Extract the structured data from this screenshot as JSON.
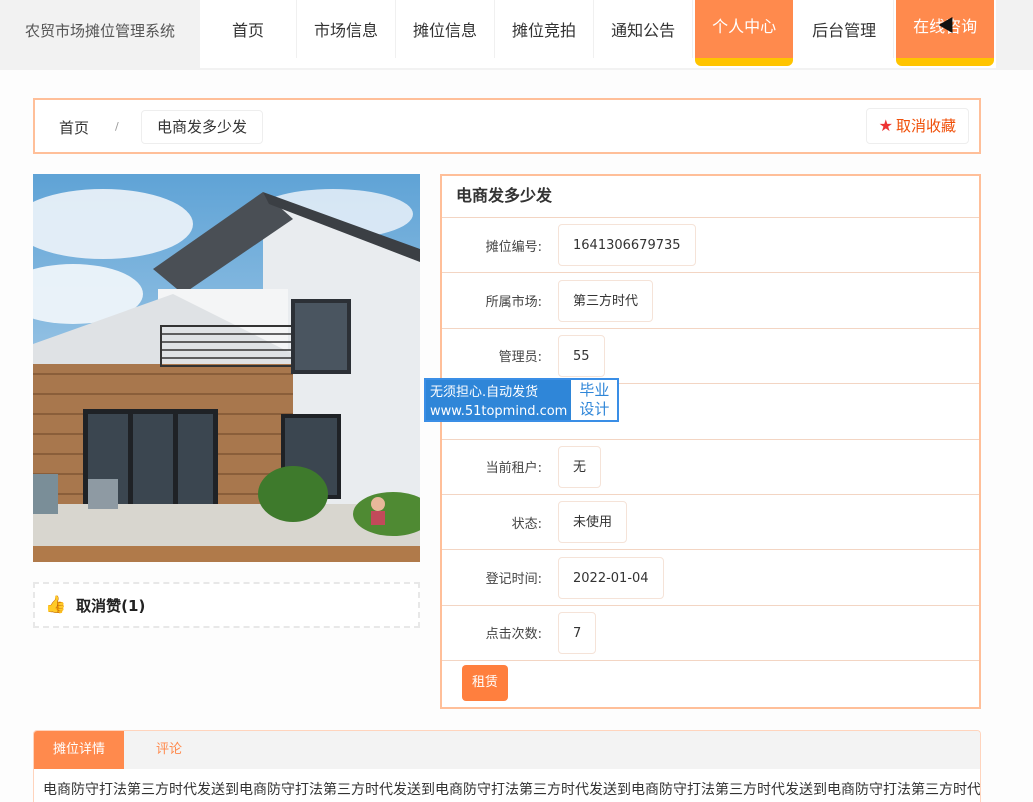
{
  "brand": "农贸市场摊位管理系统",
  "nav": [
    {
      "label": "首页",
      "active": false
    },
    {
      "label": "市场信息",
      "active": false
    },
    {
      "label": "摊位信息",
      "active": false
    },
    {
      "label": "摊位竞拍",
      "active": false
    },
    {
      "label": "通知公告",
      "active": false
    },
    {
      "label": "个人中心",
      "active": true
    },
    {
      "label": "后台管理",
      "active": false
    },
    {
      "label": "在线咨询",
      "active": true
    }
  ],
  "breadcrumb": {
    "home": "首页",
    "separator": "/",
    "current": "电商发多少发"
  },
  "favorite_button": "取消收藏",
  "like_label": "取消赞(1)",
  "info": {
    "title": "电商发多少发",
    "rows": [
      {
        "label": "摊位编号:",
        "value": "1641306679735"
      },
      {
        "label": "所属市场:",
        "value": "第三方时代"
      },
      {
        "label": "管理员:",
        "value": "55"
      },
      {
        "label": "",
        "value": ""
      },
      {
        "label": "当前租户:",
        "value": "无"
      },
      {
        "label": "状态:",
        "value": "未使用"
      },
      {
        "label": "登记时间:",
        "value": "2022-01-04"
      },
      {
        "label": "点击次数:",
        "value": "7"
      }
    ],
    "rent_button": "租赁"
  },
  "watermark": {
    "line1": "无须担心.自动发货",
    "line2": "www.51topmind.com",
    "right1": "毕业",
    "right2": "设计"
  },
  "tabs": [
    {
      "label": "摊位详情",
      "active": true
    },
    {
      "label": "评论",
      "active": false
    }
  ],
  "detail_text": "电商防守打法第三方时代发送到电商防守打法第三方时代发送到电商防守打法第三方时代发送到电商防守打法第三方时代发送到电商防守打法第三方时代发",
  "colors": {
    "accent": "#ff8a4d",
    "highlight": "#ffc400",
    "favorite": "#f0500a"
  }
}
